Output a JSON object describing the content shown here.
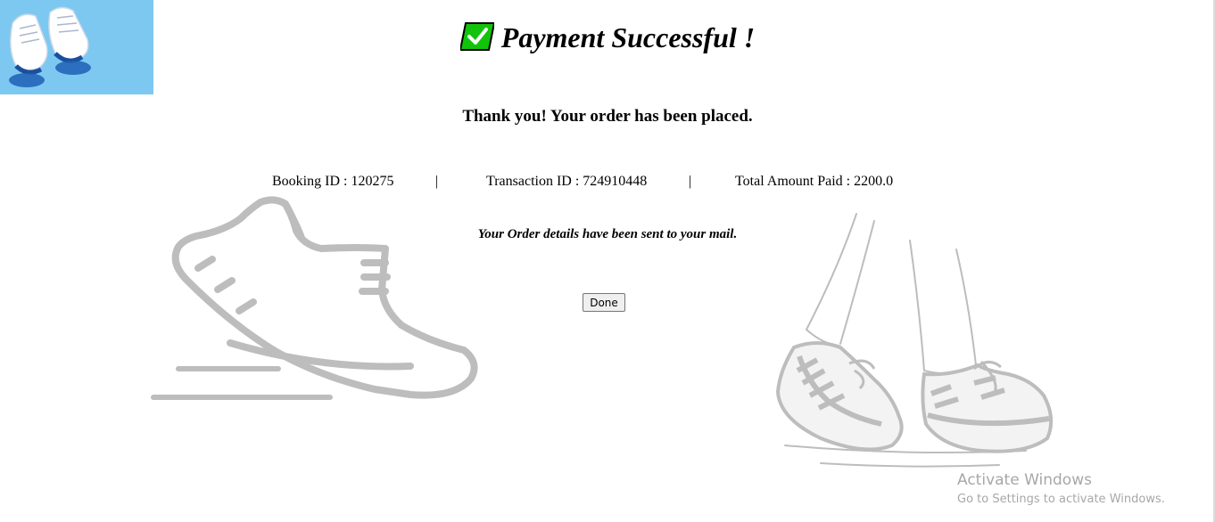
{
  "header": {
    "title": "Payment Successful !",
    "title_icon": "check-mark-box-icon",
    "logo_icon": "sneakers-logo-icon"
  },
  "confirmation": {
    "thanks": "Thank you! Your order has been placed.",
    "booking_id": "Booking ID : 120275",
    "separator": "|",
    "transaction_id": "Transaction ID : 724910448",
    "total_paid": "Total Amount Paid : 2200.0",
    "mail_note": "Your Order details have been sent to your mail."
  },
  "actions": {
    "done_label": "Done"
  },
  "decorations": {
    "left_illustration": "running-shoe-icon",
    "right_illustration": "walking-feet-sneakers-icon"
  },
  "os_watermark": {
    "title": "Activate Windows",
    "subtitle": "Go to Settings to activate Windows."
  },
  "colors": {
    "logo_bg": "#7cc8f1",
    "check_green": "#11c40b",
    "illustration_gray": "#bdbdbd",
    "watermark_gray": "#a7a7a7"
  }
}
